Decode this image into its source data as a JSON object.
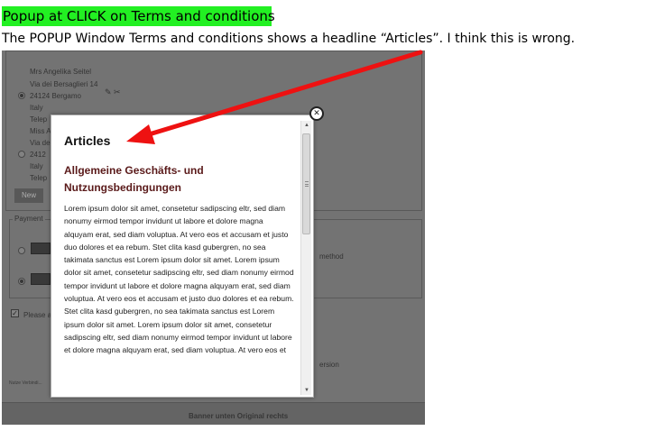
{
  "annotation": {
    "highlight_title": "Popup at CLICK on Terms and conditions",
    "description": "The POPUP Window Terms and conditions shows a headline “Articles”.  I think this is wrong."
  },
  "background_page": {
    "address_lines": [
      "Mrs Angelika Seitel",
      "Via dei Bersaglieri 14",
      "24124 Bergamo",
      "Italy",
      "Telep",
      "Miss A",
      "Via de",
      "2412",
      "Italy",
      "Telep"
    ],
    "new_button": "New",
    "payment_legend": "Payment",
    "payment_method_text": "method",
    "please_text": "Please a",
    "version_text": "ersion",
    "footer_small": "Nutze Verbindi...",
    "banner_text": "Banner unten Original rechts"
  },
  "popup": {
    "heading": "Articles",
    "subheading": "Allgemeine Geschäfts- und Nutzungsbedingungen",
    "body": "Lorem ipsum dolor sit amet, consetetur sadipscing eltr, sed diam nonumy eirmod tempor invidunt ut labore et dolore magna alquyam erat, sed diam voluptua. At vero eos et accusam et justo duo dolores et ea rebum. Stet clita kasd gubergren, no sea takimata sanctus est Lorem ipsum dolor sit amet. Lorem ipsum dolor sit amet, consetetur sadipscing eltr, sed diam nonumy eirmod tempor invidunt ut labore et dolore magna alquyam erat, sed diam voluptua. At vero eos et accusam et justo duo dolores et ea rebum. Stet clita kasd gubergren, no sea takimata sanctus est Lorem ipsum dolor sit amet. Lorem ipsum dolor sit amet, consetetur sadipscing eltr, sed diam nonumy eirmod tempor invidunt ut labore et dolore magna alquyam erat, sed diam voluptua. At vero eos et",
    "close_icon": "close-circle-icon",
    "scroll_up_glyph": "▲",
    "scroll_down_glyph": "▼"
  },
  "colors": {
    "highlight": "#22f022",
    "arrow": "#ee1111",
    "subheading": "#5a1a1a"
  }
}
